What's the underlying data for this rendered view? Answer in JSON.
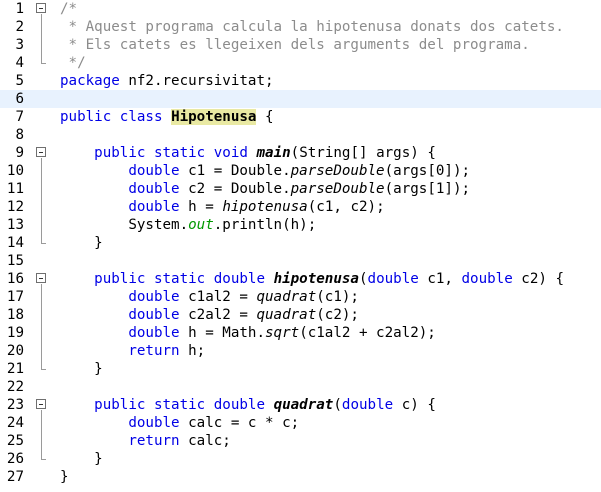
{
  "editor": {
    "current_line": 6,
    "lines": [
      {
        "n": "1",
        "tokens": [
          [
            "cm",
            "/*"
          ]
        ]
      },
      {
        "n": "2",
        "tokens": [
          [
            "cm",
            " * Aquest programa calcula la hipotenusa donats dos catets."
          ]
        ]
      },
      {
        "n": "3",
        "tokens": [
          [
            "cm",
            " * Els catets es llegeixen dels arguments del programa."
          ]
        ]
      },
      {
        "n": "4",
        "tokens": [
          [
            "cm",
            " */"
          ]
        ]
      },
      {
        "n": "5",
        "tokens": [
          [
            "kw",
            "package"
          ],
          [
            "",
            " nf2.recursivitat;"
          ]
        ]
      },
      {
        "n": "6",
        "tokens": []
      },
      {
        "n": "7",
        "tokens": [
          [
            "kw",
            "public"
          ],
          [
            "",
            " "
          ],
          [
            "kw",
            "class"
          ],
          [
            "",
            " "
          ],
          [
            "cls-hl",
            "Hipotenusa"
          ],
          [
            "",
            " {"
          ]
        ]
      },
      {
        "n": "8",
        "tokens": []
      },
      {
        "n": "9",
        "tokens": [
          [
            "",
            "    "
          ],
          [
            "kw",
            "public"
          ],
          [
            "",
            " "
          ],
          [
            "kw",
            "static"
          ],
          [
            "",
            " "
          ],
          [
            "kw",
            "void"
          ],
          [
            "",
            " "
          ],
          [
            "mth",
            "main"
          ],
          [
            "",
            "(String[] args) {"
          ]
        ]
      },
      {
        "n": "10",
        "tokens": [
          [
            "",
            "        "
          ],
          [
            "kw",
            "double"
          ],
          [
            "",
            " c1 = Double."
          ],
          [
            "it",
            "parseDouble"
          ],
          [
            "",
            "(args[0]);"
          ]
        ]
      },
      {
        "n": "11",
        "tokens": [
          [
            "",
            "        "
          ],
          [
            "kw",
            "double"
          ],
          [
            "",
            " c2 = Double."
          ],
          [
            "it",
            "parseDouble"
          ],
          [
            "",
            "(args[1]);"
          ]
        ]
      },
      {
        "n": "12",
        "tokens": [
          [
            "",
            "        "
          ],
          [
            "kw",
            "double"
          ],
          [
            "",
            " h = "
          ],
          [
            "it",
            "hipotenusa"
          ],
          [
            "",
            "(c1, c2);"
          ]
        ]
      },
      {
        "n": "13",
        "tokens": [
          [
            "",
            "        System."
          ],
          [
            "fld",
            "out"
          ],
          [
            "",
            ".println(h);"
          ]
        ]
      },
      {
        "n": "14",
        "tokens": [
          [
            "",
            "    }"
          ]
        ]
      },
      {
        "n": "15",
        "tokens": []
      },
      {
        "n": "16",
        "tokens": [
          [
            "",
            "    "
          ],
          [
            "kw",
            "public"
          ],
          [
            "",
            " "
          ],
          [
            "kw",
            "static"
          ],
          [
            "",
            " "
          ],
          [
            "kw",
            "double"
          ],
          [
            "",
            " "
          ],
          [
            "mth",
            "hipotenusa"
          ],
          [
            "",
            "("
          ],
          [
            "kw",
            "double"
          ],
          [
            "",
            " c1, "
          ],
          [
            "kw",
            "double"
          ],
          [
            "",
            " c2) {"
          ]
        ]
      },
      {
        "n": "17",
        "tokens": [
          [
            "",
            "        "
          ],
          [
            "kw",
            "double"
          ],
          [
            "",
            " c1al2 = "
          ],
          [
            "it",
            "quadrat"
          ],
          [
            "",
            "(c1);"
          ]
        ]
      },
      {
        "n": "18",
        "tokens": [
          [
            "",
            "        "
          ],
          [
            "kw",
            "double"
          ],
          [
            "",
            " c2al2 = "
          ],
          [
            "it",
            "quadrat"
          ],
          [
            "",
            "(c2);"
          ]
        ]
      },
      {
        "n": "19",
        "tokens": [
          [
            "",
            "        "
          ],
          [
            "kw",
            "double"
          ],
          [
            "",
            " h = Math."
          ],
          [
            "it",
            "sqrt"
          ],
          [
            "",
            "(c1al2 + c2al2);"
          ]
        ]
      },
      {
        "n": "20",
        "tokens": [
          [
            "",
            "        "
          ],
          [
            "kw",
            "return"
          ],
          [
            "",
            " h;"
          ]
        ]
      },
      {
        "n": "21",
        "tokens": [
          [
            "",
            "    }"
          ]
        ]
      },
      {
        "n": "22",
        "tokens": []
      },
      {
        "n": "23",
        "tokens": [
          [
            "",
            "    "
          ],
          [
            "kw",
            "public"
          ],
          [
            "",
            " "
          ],
          [
            "kw",
            "static"
          ],
          [
            "",
            " "
          ],
          [
            "kw",
            "double"
          ],
          [
            "",
            " "
          ],
          [
            "mth",
            "quadrat"
          ],
          [
            "",
            "("
          ],
          [
            "kw",
            "double"
          ],
          [
            "",
            " c) {"
          ]
        ]
      },
      {
        "n": "24",
        "tokens": [
          [
            "",
            "        "
          ],
          [
            "kw",
            "double"
          ],
          [
            "",
            " calc = c * c;"
          ]
        ]
      },
      {
        "n": "25",
        "tokens": [
          [
            "",
            "        "
          ],
          [
            "kw",
            "return"
          ],
          [
            "",
            " calc;"
          ]
        ]
      },
      {
        "n": "26",
        "tokens": [
          [
            "",
            "    }"
          ]
        ]
      },
      {
        "n": "27",
        "tokens": [
          [
            "",
            "}"
          ]
        ]
      }
    ],
    "fold_markers": [
      1,
      9,
      16,
      23
    ]
  },
  "colors": {
    "keyword": "#0000e6",
    "comment": "#8c8c8c",
    "class_highlight": "#e9e9a3",
    "field": "#009900",
    "current_line": "#e8f2fe"
  }
}
